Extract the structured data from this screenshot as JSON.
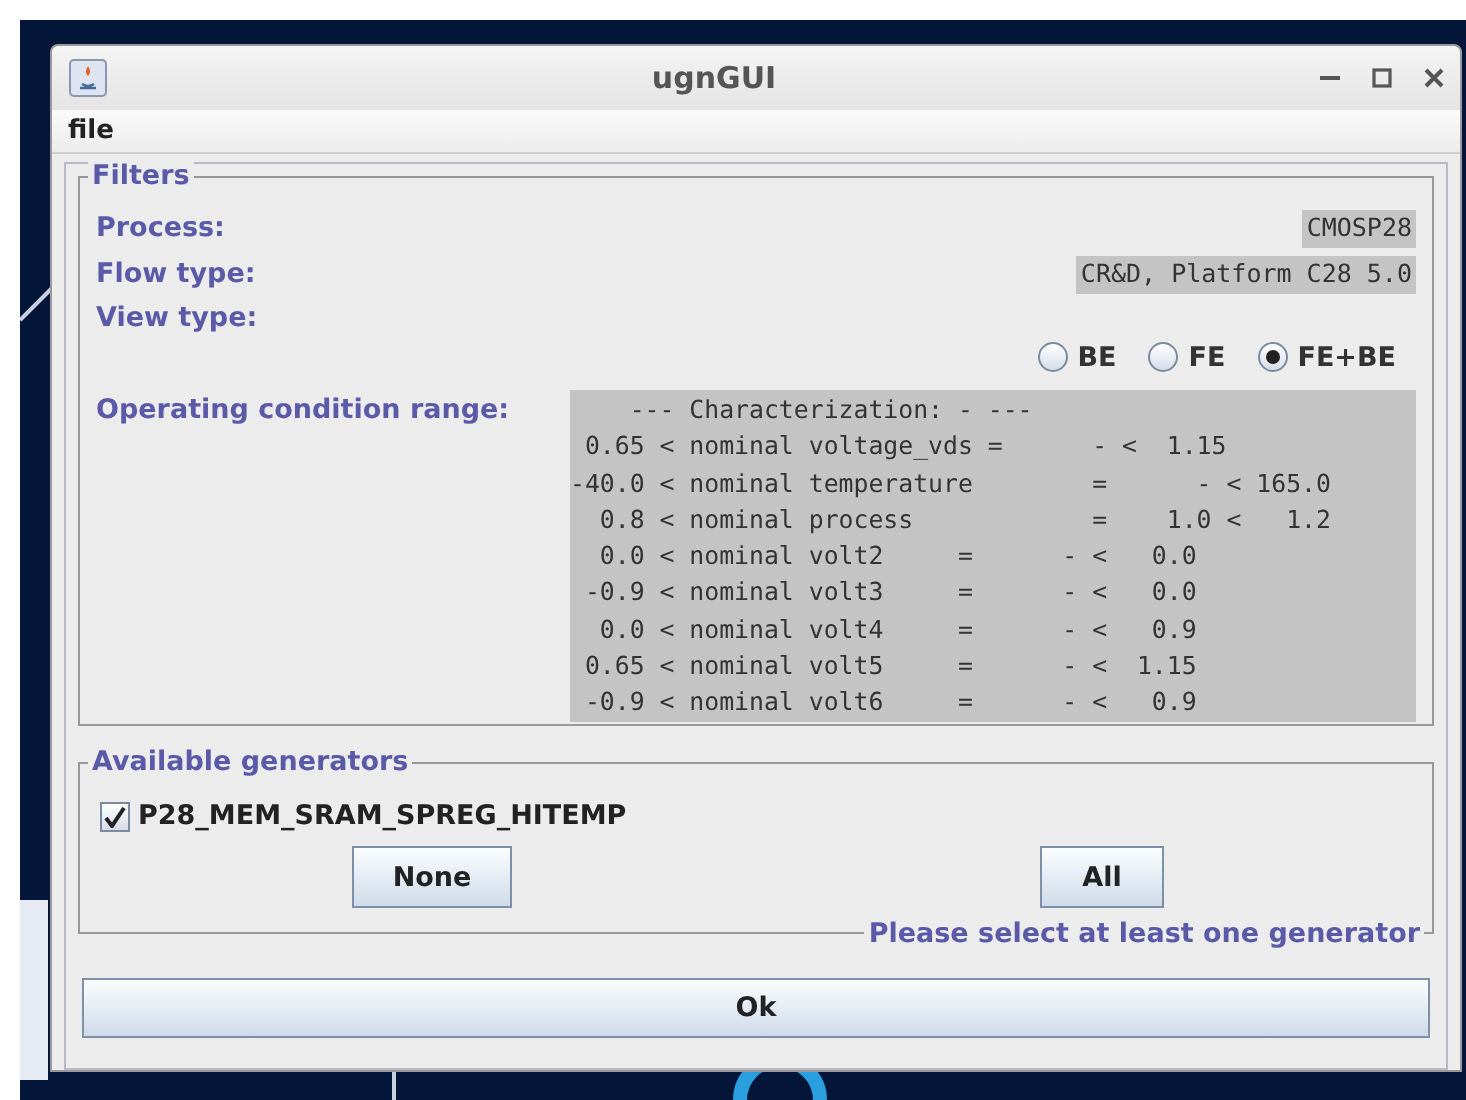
{
  "window": {
    "title": "ugnGUI"
  },
  "menu": [
    "file"
  ],
  "filters": {
    "title": "Filters",
    "fields": [
      {
        "label": "Process:",
        "value": "CMOSP28"
      },
      {
        "label": "Flow type:",
        "value": "CR&D, Platform C28 5.0"
      }
    ],
    "view_type": {
      "label": "View type:",
      "options": [
        {
          "label": "BE",
          "selected": false
        },
        {
          "label": "FE",
          "selected": false
        },
        {
          "label": "FE+BE",
          "selected": true
        }
      ]
    },
    "operating_range": {
      "label": "Operating condition range:",
      "lines": [
        "    --- Characterization: - ---",
        " 0.65 < nominal voltage_vds =      - <  1.15",
        "-40.0 < nominal temperature        =      - < 165.0",
        "  0.8 < nominal process            =    1.0 <   1.2",
        "  0.0 < nominal volt2     =      - <   0.0",
        " -0.9 < nominal volt3     =      - <   0.0",
        "  0.0 < nominal volt4     =      - <   0.9",
        " 0.65 < nominal volt5     =      - <  1.15",
        " -0.9 < nominal volt6     =      - <   0.9"
      ]
    }
  },
  "generators": {
    "title": "Available generators",
    "items": [
      {
        "label": "P28_MEM_SRAM_SPREG_HITEMP",
        "checked": true
      }
    ],
    "buttons": [
      "None",
      "All"
    ],
    "hint": "Please select at least one generator"
  },
  "ok_button": "Ok"
}
